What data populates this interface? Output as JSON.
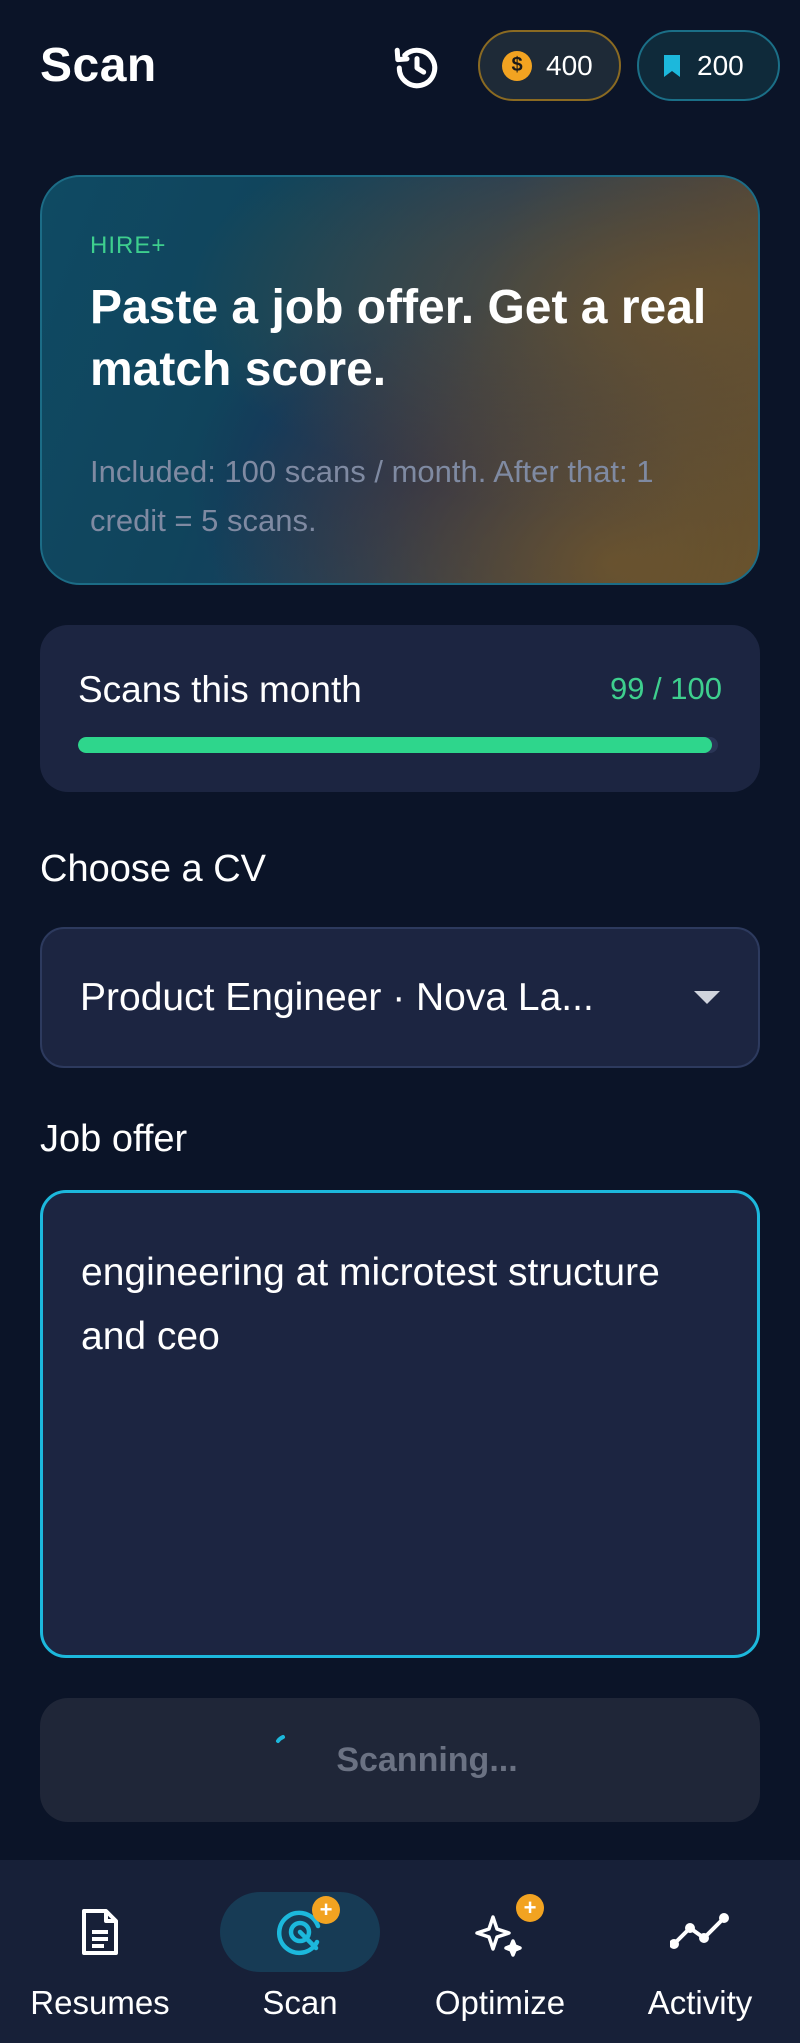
{
  "header": {
    "title": "Scan",
    "coins": "400",
    "bookmarks": "200",
    "icons": {
      "history": "history-icon",
      "coin": "coin-dollar-icon",
      "bookmark": "bookmark-icon"
    }
  },
  "hero": {
    "tag": "HIRE+",
    "title": "Paste a job offer. Get a real match score.",
    "subtitle": "Included: 100 scans / month. After that: 1 credit = 5 scans."
  },
  "usage": {
    "label": "Scans this month",
    "count_text": "99 / 100",
    "used": 99,
    "total": 100
  },
  "cv": {
    "label": "Choose a CV",
    "selected": "Product Engineer · Nova La..."
  },
  "job_offer": {
    "label": "Job offer",
    "value": "engineering at microtest structure and ceo"
  },
  "scan_button": {
    "label": "Scanning...",
    "state": "loading"
  },
  "nav": {
    "items": [
      {
        "label": "Resumes",
        "icon": "document-icon",
        "active": false
      },
      {
        "label": "Scan",
        "icon": "scan-target-icon",
        "active": true
      },
      {
        "label": "Optimize",
        "icon": "sparkles-icon",
        "active": false
      },
      {
        "label": "Activity",
        "icon": "activity-line-icon",
        "active": false
      }
    ]
  },
  "colors": {
    "background": "#0b1428",
    "card": "#1c2541",
    "accent_green": "#3ecf8e",
    "accent_cyan": "#1cb8dc",
    "coin_orange": "#f2a321"
  }
}
